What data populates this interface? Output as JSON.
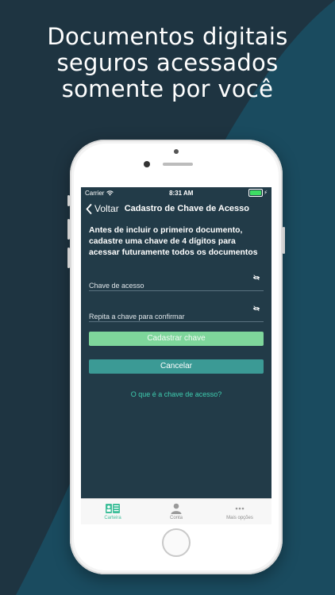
{
  "marketing": {
    "headline_lines": [
      "Documentos digitais",
      "seguros acessados",
      "somente por você"
    ]
  },
  "status_bar": {
    "carrier": "Carrier",
    "time": "8:31 AM"
  },
  "nav": {
    "back_label": "Voltar",
    "title": "Cadastro de Chave de Acesso"
  },
  "form": {
    "intro": "Antes de incluir o primeiro documento, cadastre uma chave de 4 dígitos para acessar futuramente todos os documentos",
    "key_placeholder": "Chave de acesso",
    "key_value": "",
    "confirm_placeholder": "Repita a chave para confirmar",
    "confirm_value": "",
    "register_label": "Cadastrar chave",
    "cancel_label": "Cancelar",
    "help_link": "O que é a chave de acesso?"
  },
  "tabbar": {
    "items": [
      {
        "label": "Carteira",
        "icon": "wallet-card-icon",
        "active": true
      },
      {
        "label": "Conta",
        "icon": "user-icon",
        "active": false
      },
      {
        "label": "Mais opções",
        "icon": "more-dots-icon",
        "active": false
      }
    ]
  },
  "colors": {
    "background": "#1e3441",
    "screen": "#223b48",
    "primary_button": "#7ed69b",
    "secondary_button": "#3b9a95",
    "link": "#3fcdb0",
    "tab_active": "#3fbf9a"
  }
}
